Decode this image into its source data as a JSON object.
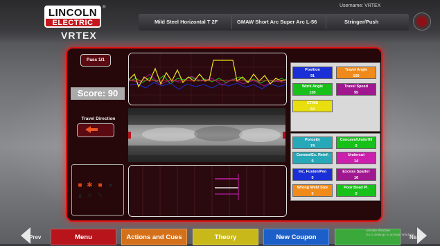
{
  "header": {
    "logo_top": "LINCOLN",
    "logo_bottom": "ELECTRIC",
    "product": "VRTEX",
    "username": "Username: VRTEX",
    "tabs": [
      "Mild Steel Horizontal T 2F",
      "GMAW Short Arc Super Arc L-56",
      "Stringer/Push"
    ]
  },
  "left": {
    "pass_label": "Pass 1/1",
    "score": "Score: 90",
    "travel_direction_label": "Travel Direction",
    "icons": [
      "helmet-icon",
      "gear-icon",
      "glove-icon",
      "eye-icon",
      "torch-icon",
      "wire-icon",
      "tool-icon"
    ]
  },
  "metrics_primary": [
    {
      "label": "Position",
      "value": "91",
      "color": "#1a2fd6"
    },
    {
      "label": "Travel Angle",
      "value": "100",
      "color": "#f08a1a"
    },
    {
      "label": "Work Angle",
      "value": "100",
      "color": "#18c01a"
    },
    {
      "label": "Travel Speed",
      "value": "95",
      "color": "#a0178f"
    },
    {
      "label": "CTWD",
      "value": "64",
      "color": "#e8de10"
    }
  ],
  "metrics_secondary": [
    {
      "label": "Porosity",
      "value": "74",
      "color": "#27a8b8"
    },
    {
      "label": "Concave/Underfill",
      "value": "0",
      "color": "#18c01a"
    },
    {
      "label": "Convex/Ex. Reinf.",
      "value": "0",
      "color": "#27a8b8"
    },
    {
      "label": "Undercut",
      "value": "14",
      "color": "#cc1fae"
    },
    {
      "label": "Inc. Fusion/Pen",
      "value": "0",
      "color": "#1a2fd6"
    },
    {
      "label": "Excess Spatter",
      "value": "16",
      "color": "#a0178f"
    },
    {
      "label": "Wrong Weld Size",
      "value": "0",
      "color": "#f08a1a"
    },
    {
      "label": "Poor Bead Pl.",
      "value": "0",
      "color": "#18c01a"
    }
  ],
  "bottom": {
    "prev": "Prev",
    "next": "Next",
    "buttons": [
      {
        "label": "Menu",
        "color": "#b8141c"
      },
      {
        "label": "Actions and Cues",
        "color": "#d4701a"
      },
      {
        "label": "Theory",
        "color": "#c9b81a"
      },
      {
        "label": "New Coupon",
        "color": "#1d5fc8"
      },
      {
        "label": "",
        "color": "#3aa83a"
      }
    ],
    "activate_line1": "Activate Windows",
    "activate_line2": "Go to Settings to activate Windows."
  }
}
